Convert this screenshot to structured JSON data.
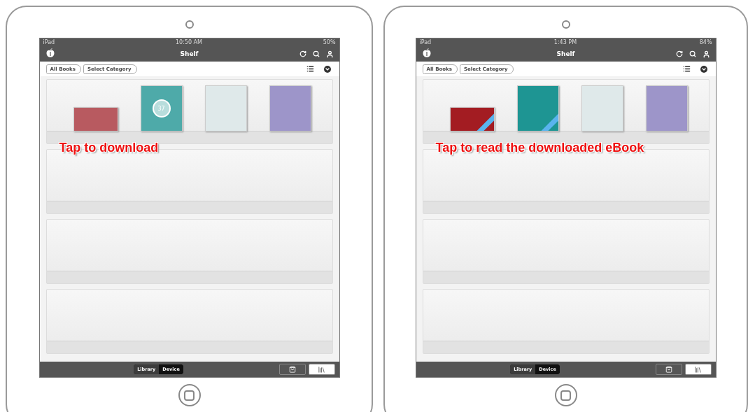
{
  "devices": [
    {
      "status_bar": {
        "carrier": "iPad",
        "time": "10:50 AM",
        "battery": "50%"
      },
      "title": "Shelf",
      "breadcrumbs": [
        {
          "label": "All Books"
        },
        {
          "label": "Select Category"
        }
      ],
      "books": [
        {
          "kind": "landscape",
          "color": "#b85a60",
          "downloaded": false
        },
        {
          "kind": "portrait",
          "color": "#4eaaa9",
          "downloaded": false,
          "progress_label": "37"
        },
        {
          "kind": "portrait",
          "color": "#dfe9ea",
          "downloaded": false
        },
        {
          "kind": "portrait",
          "color": "#9d95c9",
          "downloaded": false
        }
      ],
      "annotation": "Tap to download",
      "segments": [
        {
          "label": "Library",
          "selected": true
        },
        {
          "label": "Device",
          "selected": false
        }
      ],
      "bottom_tabs": [
        {
          "kind": "store",
          "selected": false
        },
        {
          "kind": "shelf",
          "selected": true
        }
      ]
    },
    {
      "status_bar": {
        "carrier": "iPad",
        "time": "1:43 PM",
        "battery": "84%"
      },
      "title": "Shelf",
      "breadcrumbs": [
        {
          "label": "All Books"
        },
        {
          "label": "Select Category"
        }
      ],
      "books": [
        {
          "kind": "landscape",
          "color": "#a31c22",
          "downloaded": true
        },
        {
          "kind": "portrait",
          "color": "#1e9593",
          "downloaded": true
        },
        {
          "kind": "portrait",
          "color": "#dfe9ea",
          "downloaded": false
        },
        {
          "kind": "portrait",
          "color": "#9d95c9",
          "downloaded": false
        }
      ],
      "annotation": "Tap to read the downloaded eBook",
      "segments": [
        {
          "label": "Library",
          "selected": true
        },
        {
          "label": "Device",
          "selected": false
        }
      ],
      "bottom_tabs": [
        {
          "kind": "store",
          "selected": false
        },
        {
          "kind": "shelf",
          "selected": true
        }
      ]
    }
  ]
}
